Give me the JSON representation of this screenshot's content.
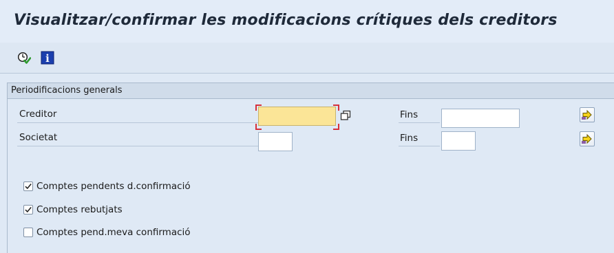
{
  "header": {
    "title": "Visualitzar/confirmar les modificacions crítiques dels creditors"
  },
  "toolbar": {
    "items": [
      {
        "icon": "execute-icon"
      },
      {
        "icon": "info-icon",
        "glyph": "i"
      }
    ]
  },
  "group": {
    "title": "Periodificacions generals",
    "fields": [
      {
        "label": "Creditor",
        "value": "",
        "to_label": "Fins",
        "to_value": ""
      },
      {
        "label": "Societat",
        "value": "",
        "to_label": "Fins",
        "to_value": ""
      }
    ],
    "checkboxes": [
      {
        "label": "Comptes pendents d.confirmació",
        "checked": true
      },
      {
        "label": "Comptes rebutjats",
        "checked": true
      },
      {
        "label": "Comptes pend.meva confirmació",
        "checked": false
      }
    ]
  },
  "colors": {
    "focused_field": "#fbe597",
    "title_text": "#1f2a3a",
    "background": "#dfe9f5"
  }
}
